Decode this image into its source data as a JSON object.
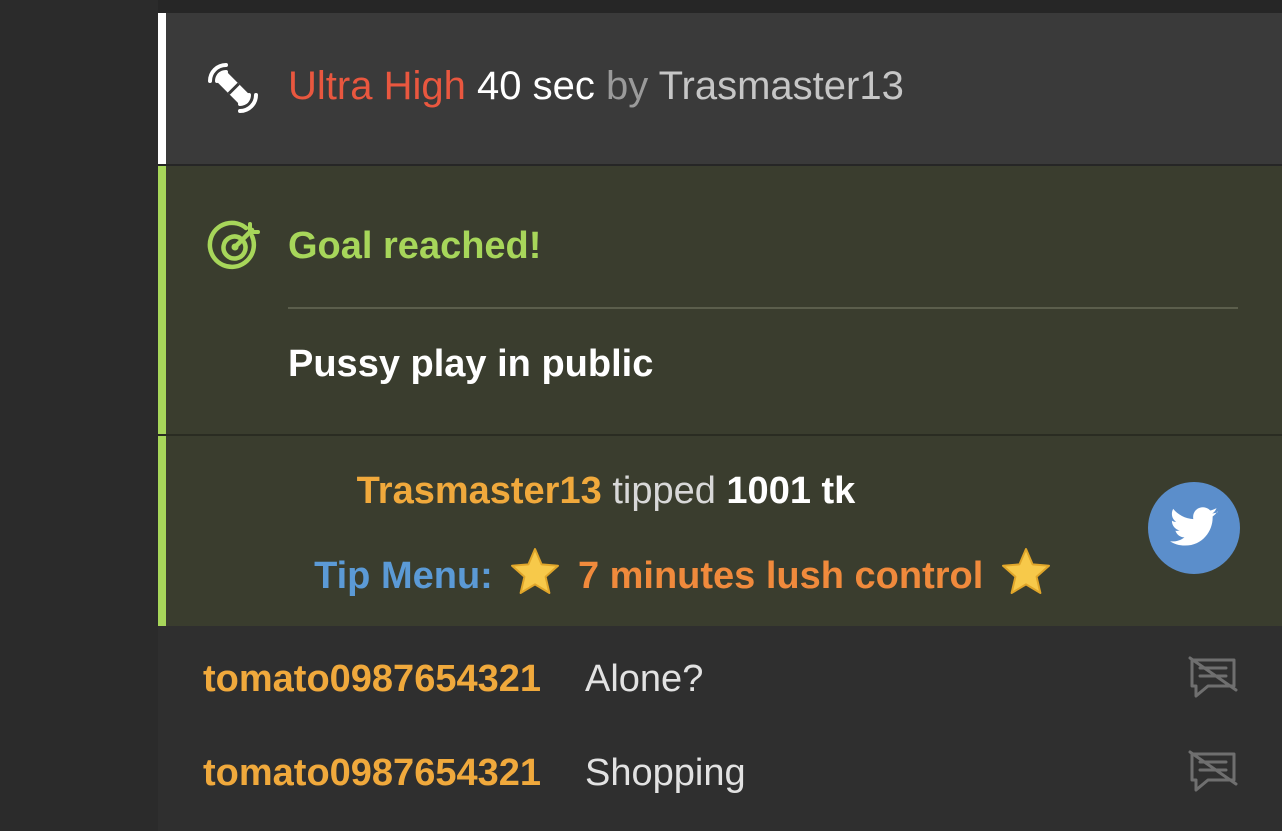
{
  "toy_notification": {
    "level": "Ultra High",
    "duration": "40 sec",
    "by": "by",
    "user": "Trasmaster13",
    "icon": "vibration-toy-icon"
  },
  "goal": {
    "title": "Goal reached!",
    "description": "Pussy play in public",
    "icon": "target-icon"
  },
  "tip": {
    "tipper": "Trasmaster13",
    "tipped_word": "tipped",
    "amount": "1001 tk",
    "menu_label": "Tip Menu:",
    "menu_item": "7 minutes lush control",
    "decoration_icon": "star-icon",
    "share_icon": "twitter-icon"
  },
  "messages": [
    {
      "user": "tomato0987654321",
      "text": "Alone?",
      "action_icon": "translate-off-icon"
    },
    {
      "user": "tomato0987654321",
      "text": "Shopping",
      "action_icon": "translate-off-icon"
    }
  ],
  "colors": {
    "toy_level": "#e9573f",
    "goal_accent": "#a7d65a",
    "username": "#f0a93c",
    "tip_menu": "#5b9ad6",
    "tip_item": "#f08a3c",
    "twitter": "#5b8ecb"
  }
}
